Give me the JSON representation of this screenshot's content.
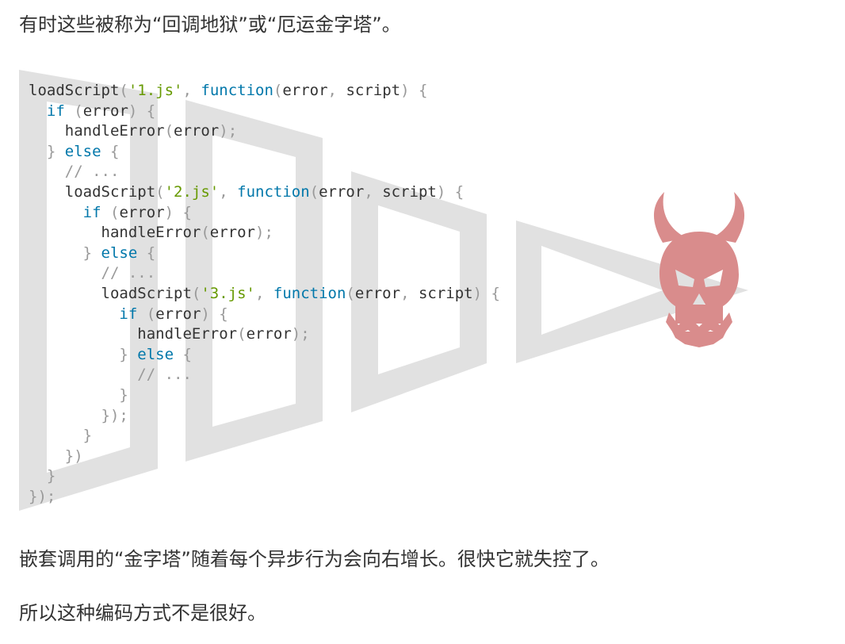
{
  "paragraphs": {
    "intro": "有时这些被称为“回调地狱”或“厄运金字塔”。",
    "pyramid": "嵌套调用的“金字塔”随着每个异步行为会向右增长。很快它就失控了。",
    "conclusion": "所以这种编码方式不是很好。"
  },
  "code": {
    "lines": [
      [
        {
          "t": "plain",
          "v": "loadScript"
        },
        {
          "t": "punc",
          "v": "("
        },
        {
          "t": "str",
          "v": "'1.js'"
        },
        {
          "t": "punc",
          "v": ", "
        },
        {
          "t": "kw",
          "v": "function"
        },
        {
          "t": "punc",
          "v": "("
        },
        {
          "t": "plain",
          "v": "error"
        },
        {
          "t": "punc",
          "v": ", "
        },
        {
          "t": "plain",
          "v": "script"
        },
        {
          "t": "punc",
          "v": ") {"
        }
      ],
      [
        {
          "t": "plain",
          "v": "  "
        },
        {
          "t": "kw",
          "v": "if"
        },
        {
          "t": "plain",
          "v": " "
        },
        {
          "t": "punc",
          "v": "("
        },
        {
          "t": "plain",
          "v": "error"
        },
        {
          "t": "punc",
          "v": ") {"
        }
      ],
      [
        {
          "t": "plain",
          "v": "    handleError"
        },
        {
          "t": "punc",
          "v": "("
        },
        {
          "t": "plain",
          "v": "error"
        },
        {
          "t": "punc",
          "v": ");"
        }
      ],
      [
        {
          "t": "plain",
          "v": "  "
        },
        {
          "t": "punc",
          "v": "} "
        },
        {
          "t": "kw",
          "v": "else"
        },
        {
          "t": "punc",
          "v": " {"
        }
      ],
      [
        {
          "t": "plain",
          "v": "    "
        },
        {
          "t": "cmt",
          "v": "// ..."
        }
      ],
      [
        {
          "t": "plain",
          "v": "    loadScript"
        },
        {
          "t": "punc",
          "v": "("
        },
        {
          "t": "str",
          "v": "'2.js'"
        },
        {
          "t": "punc",
          "v": ", "
        },
        {
          "t": "kw",
          "v": "function"
        },
        {
          "t": "punc",
          "v": "("
        },
        {
          "t": "plain",
          "v": "error"
        },
        {
          "t": "punc",
          "v": ", "
        },
        {
          "t": "plain",
          "v": "script"
        },
        {
          "t": "punc",
          "v": ") {"
        }
      ],
      [
        {
          "t": "plain",
          "v": "      "
        },
        {
          "t": "kw",
          "v": "if"
        },
        {
          "t": "plain",
          "v": " "
        },
        {
          "t": "punc",
          "v": "("
        },
        {
          "t": "plain",
          "v": "error"
        },
        {
          "t": "punc",
          "v": ") {"
        }
      ],
      [
        {
          "t": "plain",
          "v": "        handleError"
        },
        {
          "t": "punc",
          "v": "("
        },
        {
          "t": "plain",
          "v": "error"
        },
        {
          "t": "punc",
          "v": ");"
        }
      ],
      [
        {
          "t": "plain",
          "v": "      "
        },
        {
          "t": "punc",
          "v": "} "
        },
        {
          "t": "kw",
          "v": "else"
        },
        {
          "t": "punc",
          "v": " {"
        }
      ],
      [
        {
          "t": "plain",
          "v": "        "
        },
        {
          "t": "cmt",
          "v": "// ..."
        }
      ],
      [
        {
          "t": "plain",
          "v": "        loadScript"
        },
        {
          "t": "punc",
          "v": "("
        },
        {
          "t": "str",
          "v": "'3.js'"
        },
        {
          "t": "punc",
          "v": ", "
        },
        {
          "t": "kw",
          "v": "function"
        },
        {
          "t": "punc",
          "v": "("
        },
        {
          "t": "plain",
          "v": "error"
        },
        {
          "t": "punc",
          "v": ", "
        },
        {
          "t": "plain",
          "v": "script"
        },
        {
          "t": "punc",
          "v": ") {"
        }
      ],
      [
        {
          "t": "plain",
          "v": "          "
        },
        {
          "t": "kw",
          "v": "if"
        },
        {
          "t": "plain",
          "v": " "
        },
        {
          "t": "punc",
          "v": "("
        },
        {
          "t": "plain",
          "v": "error"
        },
        {
          "t": "punc",
          "v": ") {"
        }
      ],
      [
        {
          "t": "plain",
          "v": "            handleError"
        },
        {
          "t": "punc",
          "v": "("
        },
        {
          "t": "plain",
          "v": "error"
        },
        {
          "t": "punc",
          "v": ");"
        }
      ],
      [
        {
          "t": "plain",
          "v": "          "
        },
        {
          "t": "punc",
          "v": "} "
        },
        {
          "t": "kw",
          "v": "else"
        },
        {
          "t": "punc",
          "v": " {"
        }
      ],
      [
        {
          "t": "plain",
          "v": "            "
        },
        {
          "t": "cmt",
          "v": "// ..."
        }
      ],
      [
        {
          "t": "plain",
          "v": "          "
        },
        {
          "t": "punc",
          "v": "}"
        }
      ],
      [
        {
          "t": "plain",
          "v": "        "
        },
        {
          "t": "punc",
          "v": "});"
        }
      ],
      [
        {
          "t": "plain",
          "v": "      "
        },
        {
          "t": "punc",
          "v": "}"
        }
      ],
      [
        {
          "t": "plain",
          "v": "    "
        },
        {
          "t": "punc",
          "v": "})"
        }
      ],
      [
        {
          "t": "plain",
          "v": "  "
        },
        {
          "t": "punc",
          "v": "}"
        }
      ],
      [
        {
          "t": "punc",
          "v": "});"
        }
      ]
    ]
  },
  "illustration": {
    "shapes_color": "#e1e1e1",
    "skull_color": "#d98c8c",
    "icon": "devil-skull-icon"
  }
}
